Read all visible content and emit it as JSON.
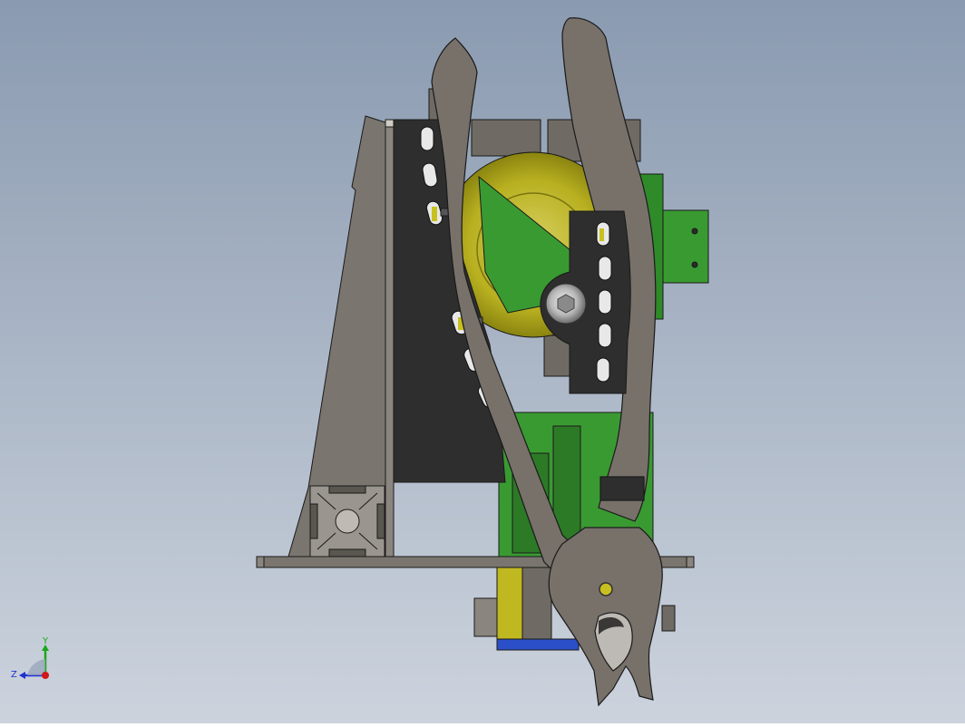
{
  "viewport": {
    "background_top": "#8a9ab0",
    "background_bottom": "#ccd3dd"
  },
  "colors": {
    "steel": "#767068",
    "steel_light": "#8a847c",
    "steel_dark": "#5a5650",
    "plate_black": "#2e2e2e",
    "bracket_green": "#3a9a32",
    "bracket_green_dark": "#2c7a26",
    "cam_yellow": "#b8b020",
    "base_blue": "#2a4fc8",
    "edge": "#1a1a1a"
  },
  "triad": {
    "x_label": "",
    "y_label": "Y",
    "z_label": "Z",
    "y_color": "#1aa81a",
    "z_color": "#2030d0",
    "x_color": "#d01818"
  }
}
